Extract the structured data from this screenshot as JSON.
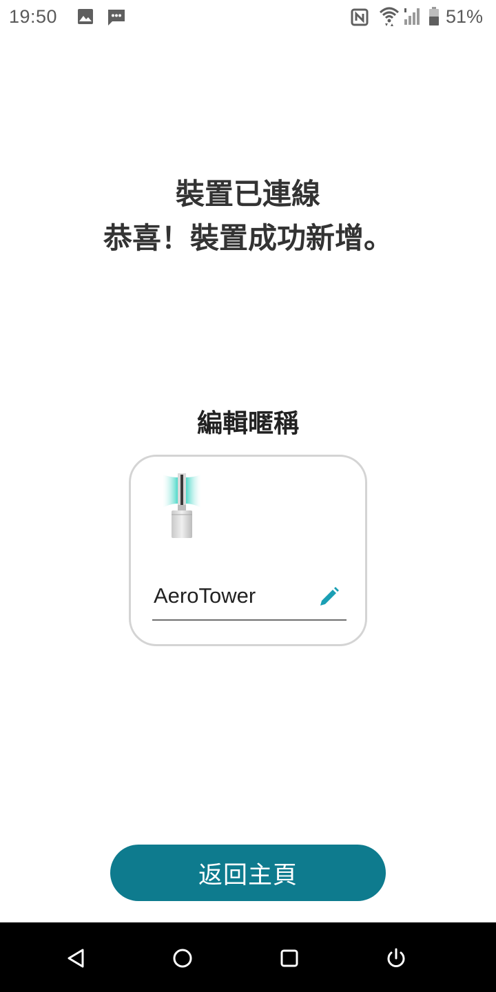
{
  "status_bar": {
    "time": "19:50",
    "battery_percent": "51%",
    "icons": [
      "image-icon",
      "message-icon",
      "nfc-icon",
      "wifi-icon",
      "signal-icon",
      "battery-icon"
    ]
  },
  "heading": {
    "line1": "裝置已連線",
    "line2": "恭喜！裝置成功新增。"
  },
  "nickname": {
    "title": "編輯暱稱",
    "device_name": "AeroTower",
    "edit_icon": "pencil-icon"
  },
  "actions": {
    "home_button_label": "返回主頁"
  },
  "nav_bar": {
    "icons": [
      "back-icon",
      "home-icon",
      "recents-icon",
      "power-icon"
    ]
  },
  "colors": {
    "accent": "#0e7b8e",
    "edit_icon": "#1a9fb4",
    "heading_text": "#333333",
    "card_border": "#d4d4d4"
  }
}
